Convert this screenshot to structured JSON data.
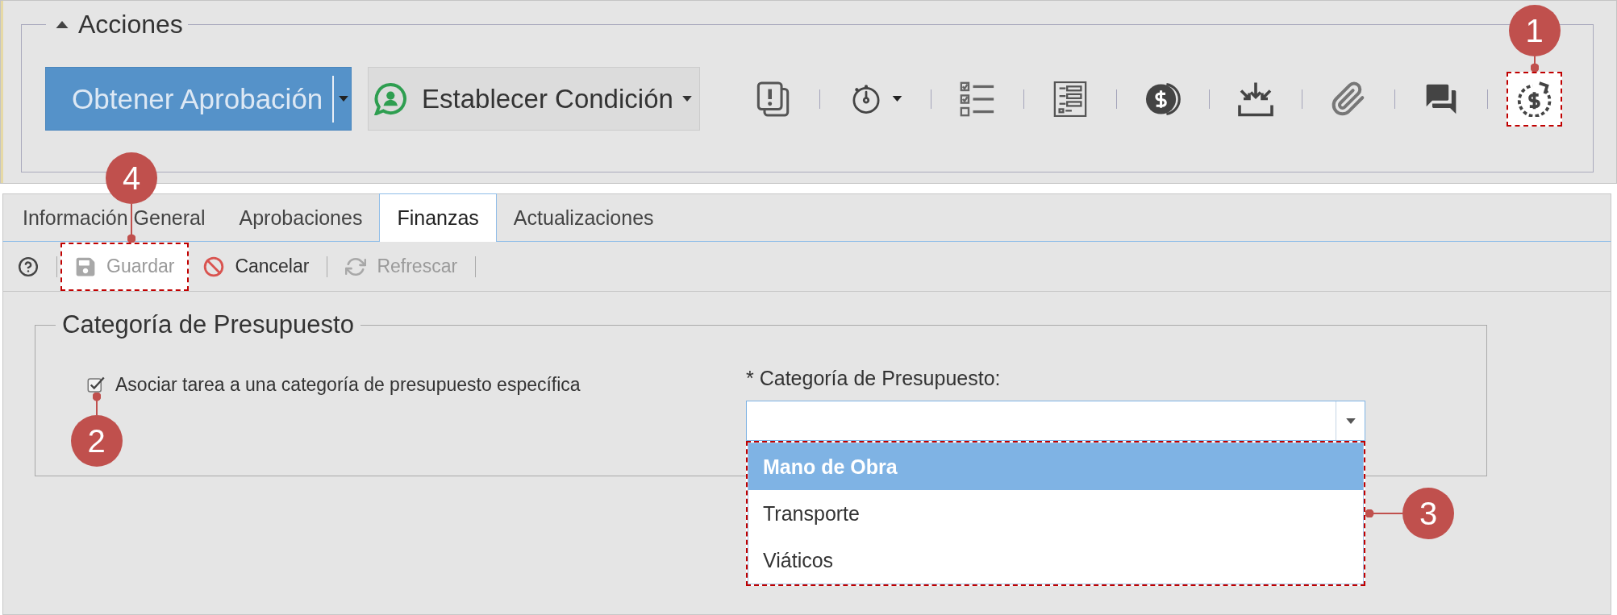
{
  "actions": {
    "title": "Acciones",
    "expanded": true,
    "approval_button": {
      "label": "Obtener Aprobación"
    },
    "condition_button": {
      "label": "Establecer Condición"
    },
    "icons": [
      {
        "kind": "alert",
        "dropdown": false,
        "highlighted": false
      },
      {
        "kind": "timer",
        "dropdown": true,
        "highlighted": false
      },
      {
        "kind": "checklist",
        "dropdown": false,
        "highlighted": false
      },
      {
        "kind": "form",
        "dropdown": false,
        "highlighted": false
      },
      {
        "kind": "coin",
        "dropdown": false,
        "highlighted": false
      },
      {
        "kind": "import",
        "dropdown": false,
        "highlighted": false
      },
      {
        "kind": "attach",
        "dropdown": false,
        "highlighted": false
      },
      {
        "kind": "chat",
        "dropdown": false,
        "highlighted": false
      },
      {
        "kind": "budget",
        "dropdown": false,
        "highlighted": true,
        "callout": "1"
      }
    ]
  },
  "tabs": [
    {
      "label": "Información General",
      "selected": false
    },
    {
      "label": "Aprobaciones",
      "selected": false
    },
    {
      "label": "Finanzas",
      "selected": true
    },
    {
      "label": "Actualizaciones",
      "selected": false
    }
  ],
  "toolbar": [
    {
      "kind": "help",
      "disabled": false,
      "highlighted": false
    },
    {
      "kind": "save",
      "label": "Guardar",
      "disabled": true,
      "highlighted": true,
      "callout": "4"
    },
    {
      "kind": "cancel",
      "label": "Cancelar",
      "disabled": false,
      "highlighted": false
    },
    {
      "kind": "refresh",
      "label": "Refrescar",
      "disabled": true,
      "highlighted": false
    }
  ],
  "budget": {
    "title": "Categoría de Presupuesto",
    "checkbox": {
      "label": "Asociar tarea a una categoría de presupuesto específica",
      "checked": true,
      "callout": "2"
    },
    "category_field": {
      "label": "* Categoría de Presupuesto:",
      "expanded": true,
      "highlighted": true,
      "callout": "3",
      "options": [
        {
          "label": "Mano de Obra",
          "selected": true
        },
        {
          "label": "Transporte",
          "selected": false
        },
        {
          "label": "Viáticos",
          "selected": false
        }
      ]
    }
  }
}
